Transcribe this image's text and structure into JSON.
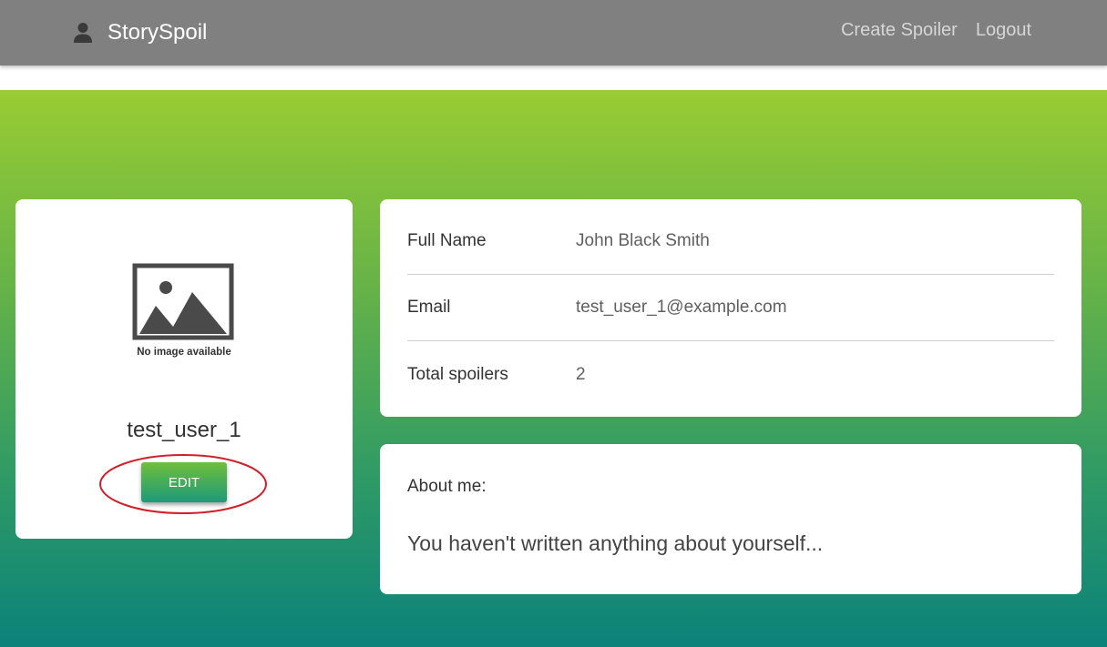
{
  "navbar": {
    "brand_icon": "user-icon",
    "brand": "StorySpoil",
    "links": [
      {
        "label": "Create Spoiler"
      },
      {
        "label": "Logout"
      }
    ]
  },
  "profile": {
    "image_caption": "No image available",
    "username": "test_user_1",
    "edit_label": "EDIT",
    "annotation_color": "#d0202a"
  },
  "details": {
    "rows": [
      {
        "label": "Full Name",
        "value": "John Black Smith"
      },
      {
        "label": "Email",
        "value": "test_user_1@example.com"
      },
      {
        "label": "Total spoilers",
        "value": "2"
      }
    ]
  },
  "about": {
    "title": "About me:",
    "text": "You haven't written anything about yourself..."
  },
  "colors": {
    "navbar_bg": "#808080",
    "gradient_top": "#99cc33",
    "gradient_bottom": "#0b827a",
    "edit_button_top": "#6fbf3b",
    "edit_button_bottom": "#1d9a7a"
  }
}
